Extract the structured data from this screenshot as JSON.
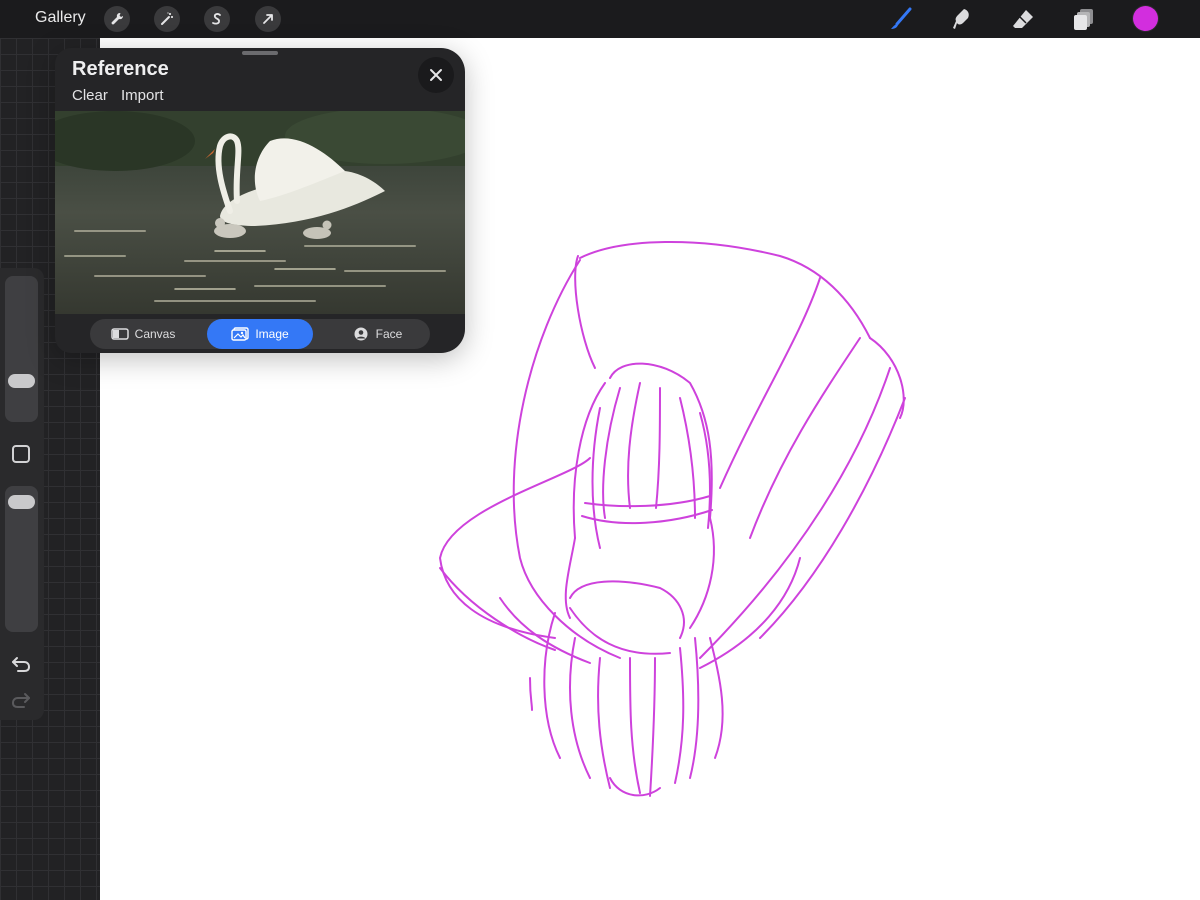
{
  "topbar": {
    "gallery_label": "Gallery",
    "left_tools": [
      "wrench-icon",
      "magic-wand-icon",
      "selection-s-icon",
      "transform-arrow-icon"
    ],
    "right_tools": [
      "brush-icon",
      "smudge-icon",
      "eraser-icon",
      "layers-icon"
    ],
    "active_tool": "brush-icon",
    "current_color": "#d22ede"
  },
  "reference_panel": {
    "title": "Reference",
    "clear_label": "Clear",
    "import_label": "Import",
    "tabs": [
      {
        "label": "Canvas",
        "icon": "canvas-icon",
        "active": false
      },
      {
        "label": "Image",
        "icon": "image-icon",
        "active": true
      },
      {
        "label": "Face",
        "icon": "face-icon",
        "active": false
      }
    ]
  },
  "sidebar": {
    "brush_size_level": 0.25,
    "opacity_level": 0.95
  },
  "colors": {
    "accent": "#3478f6",
    "stroke": "#c92ed9",
    "canvas": "#ffffff",
    "workspace": "#222224"
  }
}
